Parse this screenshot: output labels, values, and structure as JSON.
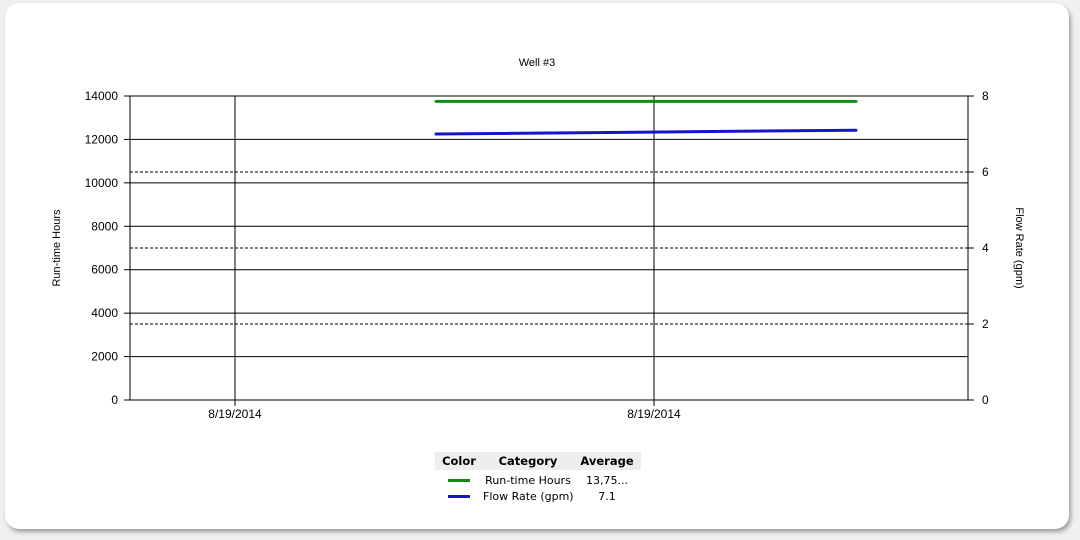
{
  "chart_data": {
    "type": "line",
    "title": "Well #3",
    "x_tick_labels": [
      "8/19/2014",
      "8/19/2014"
    ],
    "y_left": {
      "label": "Run-time Hours",
      "ylim": [
        0,
        14000
      ],
      "ticks": [
        0,
        2000,
        4000,
        6000,
        8000,
        10000,
        12000,
        14000
      ]
    },
    "y_right": {
      "label": "Flow Rate (gpm)",
      "ylim": [
        0,
        8
      ],
      "ticks": [
        0,
        2,
        4,
        6,
        8
      ]
    },
    "grid": true,
    "series": [
      {
        "name": "Run-time Hours",
        "axis": "left",
        "color": "#138a13",
        "values": [
          13750,
          13750
        ]
      },
      {
        "name": "Flow Rate (gpm)",
        "axis": "right",
        "color": "#1414c8",
        "values": [
          7.0,
          7.1
        ]
      }
    ],
    "legend": {
      "placement": "bottom",
      "headers": {
        "color": "Color",
        "category": "Category",
        "average": "Average"
      },
      "rows": [
        {
          "color": "#138a13",
          "category": "Run-time Hours",
          "average": "13,75..."
        },
        {
          "color": "#1414c8",
          "category": "Flow Rate (gpm)",
          "average": "7.1"
        }
      ]
    }
  }
}
